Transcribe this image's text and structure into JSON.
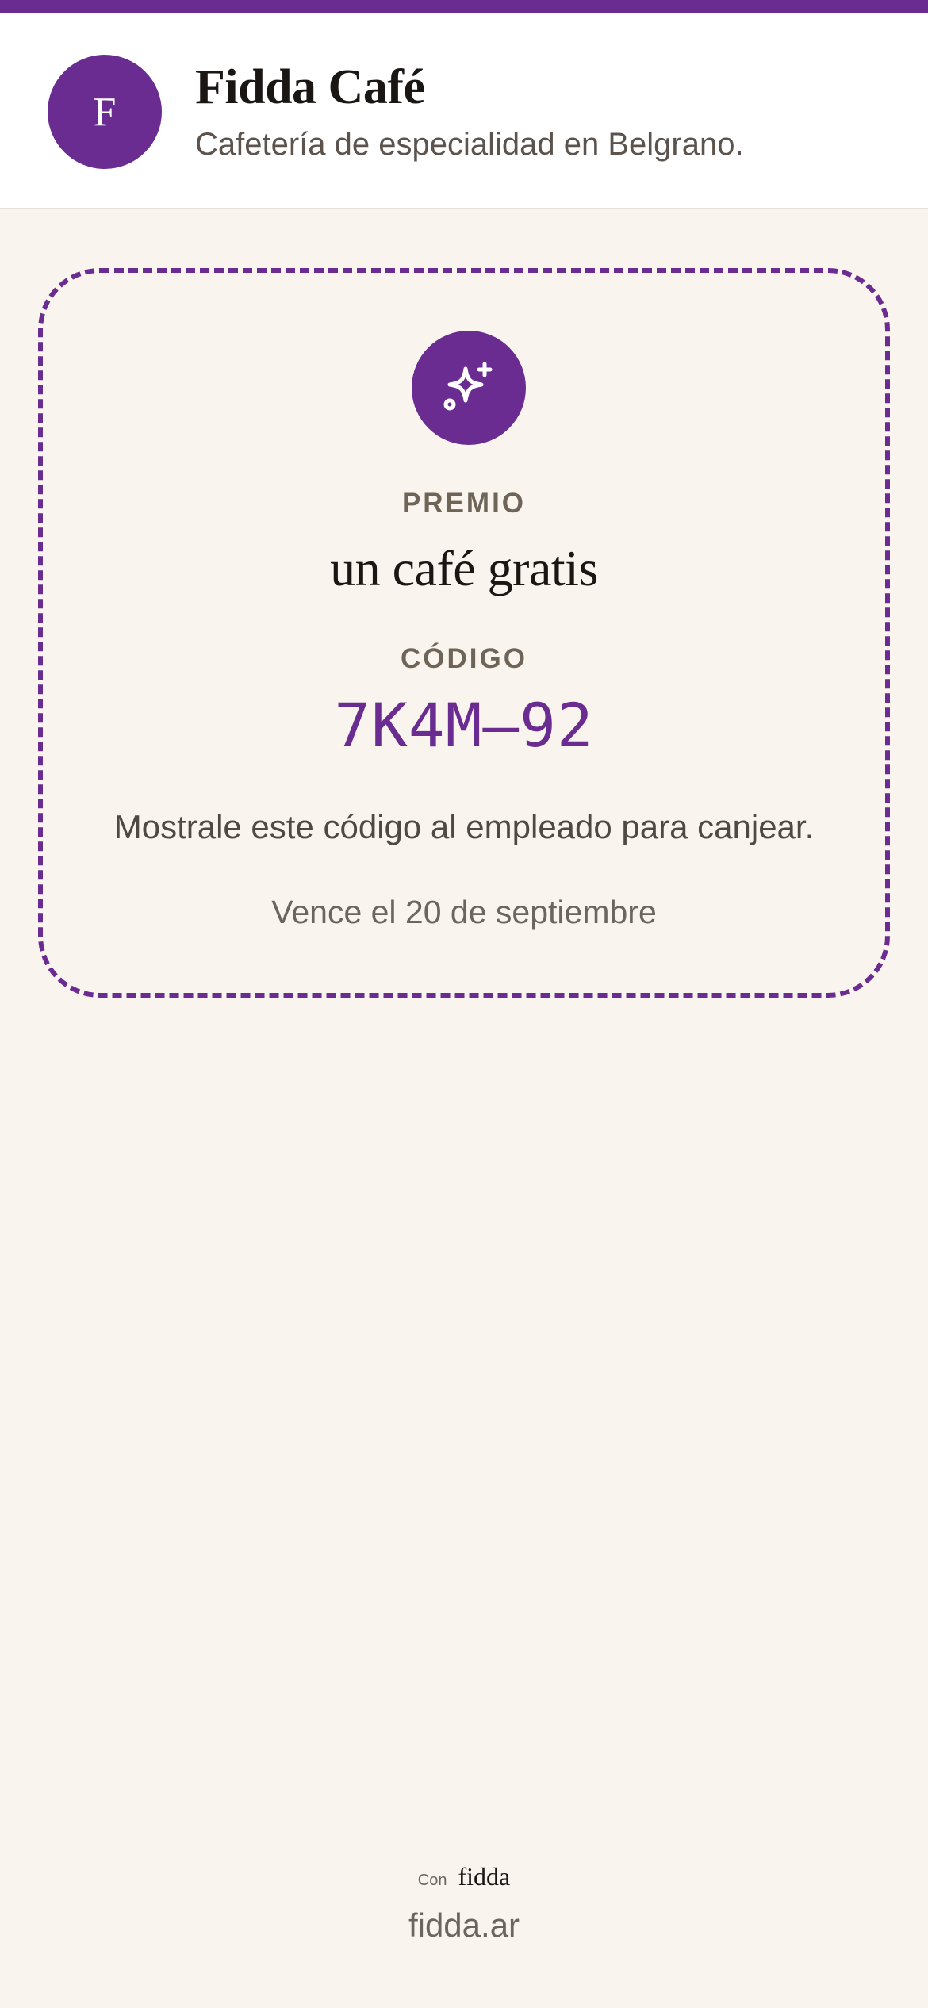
{
  "colors": {
    "accent": "#6a2c91",
    "background": "#f9f4ee",
    "header_bg": "#ffffff",
    "text_primary": "#1a1614",
    "text_secondary": "#5c534d"
  },
  "header": {
    "avatar_letter": "F",
    "business_name": "Fidda Café",
    "business_description": "Cafetería de especialidad en Belgrano."
  },
  "reward": {
    "icon": "sparkles-icon",
    "label": "PREMIO",
    "title": "un café gratis",
    "code_label": "CÓDIGO",
    "code": "7K4M–92",
    "instructions": "Mostrale este código al empleado para canjear.",
    "expiry": "Vence el 20 de septiembre"
  },
  "footer": {
    "powered_prefix": "Con",
    "powered_brand": "fidda",
    "link_text": "fidda.ar"
  }
}
